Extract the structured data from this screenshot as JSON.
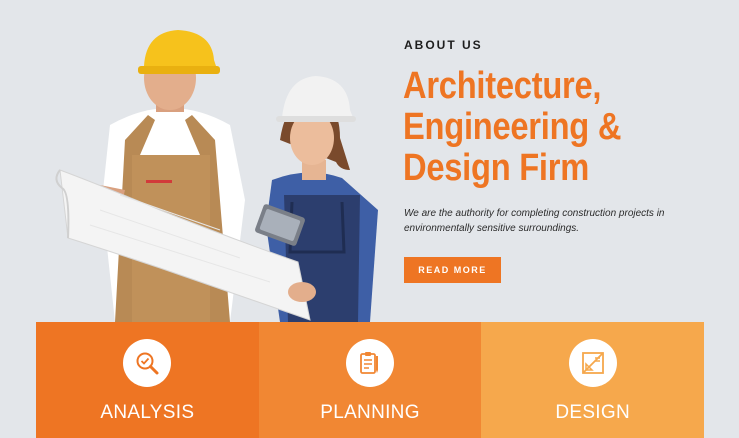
{
  "hero": {
    "eyebrow": "ABOUT US",
    "title_lines": [
      "Architecture,",
      "Engineering &",
      "Design Firm"
    ],
    "description": "We are the authority for completing construction projects in environmentally sensitive surroundings.",
    "cta_label": "READ MORE"
  },
  "features": [
    {
      "label": "ANALYSIS",
      "icon": "magnifier-analysis-icon",
      "color": "#ee7523"
    },
    {
      "label": "PLANNING",
      "icon": "clipboard-pencil-icon",
      "color": "#f18733"
    },
    {
      "label": "DESIGN",
      "icon": "drafting-ruler-icon",
      "color": "#f6a84c"
    }
  ],
  "colors": {
    "accent": "#ee7523",
    "background": "#e3e6ea"
  }
}
